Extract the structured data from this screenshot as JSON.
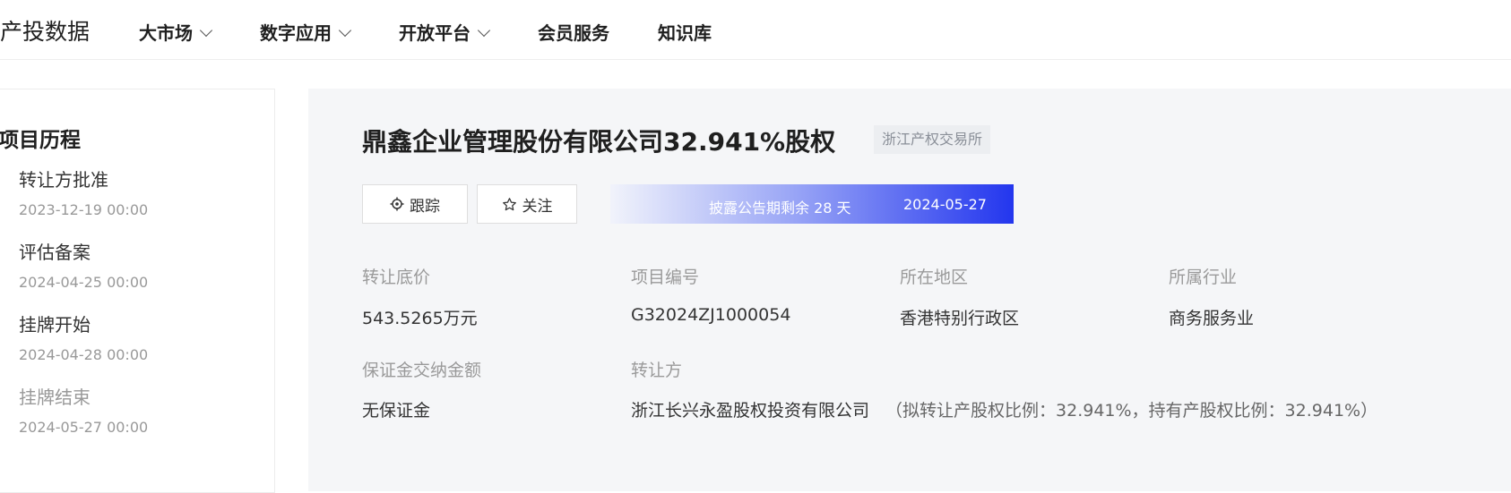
{
  "nav": {
    "brand": "产投数据",
    "items": [
      {
        "label": "大市场",
        "dropdown": true
      },
      {
        "label": "数字应用",
        "dropdown": true
      },
      {
        "label": "开放平台",
        "dropdown": true
      },
      {
        "label": "会员服务",
        "dropdown": false
      },
      {
        "label": "知识库",
        "dropdown": false
      }
    ]
  },
  "sidebar": {
    "title": "项目历程",
    "steps": [
      {
        "name": "转让方批准",
        "time": "2023-12-19 00:00"
      },
      {
        "name": "评估备案",
        "time": "2024-04-25 00:00"
      },
      {
        "name": "挂牌开始",
        "time": "2024-04-28 00:00"
      },
      {
        "name": "挂牌结束",
        "time": "2024-05-27 00:00"
      }
    ]
  },
  "project": {
    "title": "鼎鑫企业管理股份有限公司32.941%股权",
    "exchange": "浙江产权交易所",
    "follow_label": "跟踪",
    "watch_label": "关注",
    "remaining": "披露公告期剩余 28 天",
    "end_date": "2024-05-27",
    "fields": {
      "price_label": "转让底价",
      "price_value": "543.5265万元",
      "code_label": "项目编号",
      "code_value": "G32024ZJ1000054",
      "region_label": "所在地区",
      "region_value": "香港特别行政区",
      "industry_label": "所属行业",
      "industry_value": "商务服务业",
      "deposit_label": "保证金交纳金额",
      "deposit_value": "无保证金",
      "seller_label": "转让方",
      "seller_value": "浙江长兴永盈股权投资有限公司",
      "seller_ratio": "（拟转让产股权比例：32.941%，持有产股权比例：32.941%）"
    }
  },
  "colors": {
    "accent": "#2336ee",
    "panel_bg": "#f5f6f8"
  },
  "icons": {
    "follow": "crosshair-icon",
    "watch": "star-icon"
  }
}
